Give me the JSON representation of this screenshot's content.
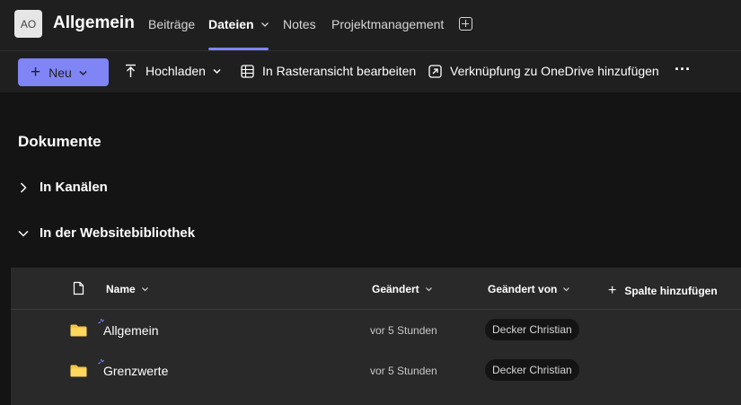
{
  "header": {
    "avatar_initials": "AO",
    "channel_title": "Allgemein",
    "tabs": [
      {
        "label": "Beiträge"
      },
      {
        "label": "Dateien"
      },
      {
        "label": "Notes"
      },
      {
        "label": "Projektmanagement"
      }
    ],
    "active_tab": "Dateien"
  },
  "toolbar": {
    "new_label": "Neu",
    "upload_label": "Hochladen",
    "grid_edit_label": "In Rasteransicht bearbeiten",
    "onedrive_label": "Verknüpfung zu OneDrive hinzufügen",
    "more_label": "···"
  },
  "main": {
    "heading": "Dokumente",
    "sections": [
      {
        "label": "In Kanälen",
        "expanded": false
      },
      {
        "label": "In der Websitebibliothek",
        "expanded": true
      }
    ]
  },
  "table": {
    "columns": {
      "name": "Name",
      "modified": "Geändert",
      "modified_by": "Geändert von",
      "add_column": "Spalte hinzufügen"
    },
    "rows": [
      {
        "name": "Allgemein",
        "modified": "vor 5 Stunden",
        "modified_by": "Decker Christian"
      },
      {
        "name": "Grenzwerte",
        "modified": "vor 5 Stunden",
        "modified_by": "Decker Christian"
      }
    ]
  },
  "colors": {
    "accent": "#7f85f5",
    "folder": "#f4c542",
    "background": "#1f1f1f",
    "table_bg": "#292929"
  },
  "icons": [
    "plus-icon",
    "upload-icon",
    "chevron-down-icon",
    "grid-icon",
    "shortcut-icon",
    "more-icon",
    "chevron-right-icon",
    "file-icon",
    "folder-icon",
    "new-item-icon",
    "add-tab-icon"
  ]
}
